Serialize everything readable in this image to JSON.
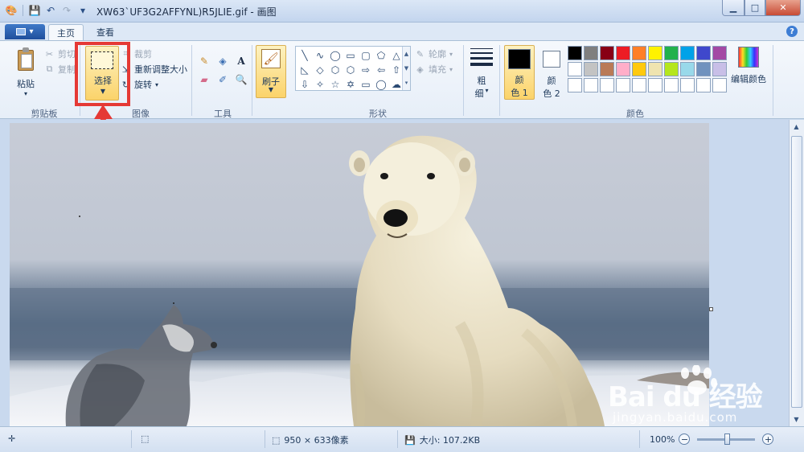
{
  "window": {
    "title": "XW63`UF3G2AFFYNL)R5JLIE.gif - 画图",
    "controls": {
      "minimize": "▁",
      "maximize": "□",
      "close": "✕"
    }
  },
  "quick_access": {
    "save": "💾",
    "undo": "↶",
    "redo": "↷",
    "customize": "▾"
  },
  "tabs": {
    "main": "主页",
    "view": "查看",
    "help": "?"
  },
  "ribbon": {
    "clipboard": {
      "label": "剪贴板",
      "paste": "粘贴",
      "cut": "剪切",
      "copy": "复制"
    },
    "image": {
      "label": "图像",
      "select": "选择",
      "crop": "裁剪",
      "resize": "重新调整大小",
      "rotate": "旋转"
    },
    "tools": {
      "label": "工具"
    },
    "brushes": {
      "label": "刷子"
    },
    "shapes": {
      "label": "形状",
      "outline": "轮廓",
      "fill": "填充"
    },
    "size": {
      "label_line1": "粗",
      "label_line2": "细"
    },
    "colors": {
      "label": "颜色",
      "color1": "颜",
      "color1_b": "色 1",
      "color2": "颜",
      "color2_b": "色 2",
      "edit": "编辑颜色",
      "color1_value": "#000000",
      "color2_value": "#ffffff",
      "palette": [
        "#000000",
        "#7f7f7f",
        "#880015",
        "#ed1c24",
        "#ff7f27",
        "#fff200",
        "#22b14c",
        "#00a2e8",
        "#3f48cc",
        "#a349a4",
        "#ffffff",
        "#c3c3c3",
        "#b97a57",
        "#ffaec9",
        "#ffc90e",
        "#efe4b0",
        "#b5e61d",
        "#99d9ea",
        "#7092be",
        "#c8bfe7",
        "#ffffff",
        "#ffffff",
        "#ffffff",
        "#ffffff",
        "#ffffff",
        "#ffffff",
        "#ffffff",
        "#ffffff",
        "#ffffff",
        "#ffffff"
      ]
    }
  },
  "shapes_icons": [
    "╲",
    "∿",
    "◯",
    "▭",
    "▢",
    "⬠",
    "△",
    "◺",
    "◇",
    "⬡",
    "⬡",
    "⇨",
    "⇦",
    "⇧",
    "⇩",
    "✧",
    "☆",
    "✡",
    "▭",
    "◯",
    "☁"
  ],
  "status": {
    "dimensions": "950 × 633像素",
    "size": "大小: 107.2KB",
    "zoom": "100%"
  },
  "watermark": {
    "main": "Bai du 经验",
    "sub": "jingyan.baidu.com"
  }
}
